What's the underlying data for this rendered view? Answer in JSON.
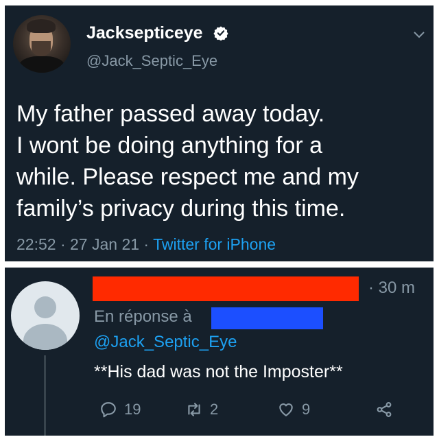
{
  "tweet": {
    "display_name": "Jacksepticeye",
    "handle": "@Jack_Septic_Eye",
    "text_lines": [
      "My father passed away today.",
      "I wont be doing anything for a",
      "while. Please respect me and my",
      "family’s privacy during this time."
    ],
    "time": "22:52",
    "date": "27 Jan 21",
    "source": "Twitter for iPhone",
    "separator": " · "
  },
  "reply": {
    "time": "· 30 m",
    "replying_to_label": "En réponse à",
    "replying_handle": "@Jack_Septic_Eye",
    "text": "**His dad was not the Imposter**",
    "counts": {
      "replies": "19",
      "retweets": "2",
      "likes": "9"
    }
  },
  "colors": {
    "background": "#15202b",
    "text": "#ffffff",
    "secondary": "#8899a6",
    "link": "#1da1f2",
    "redact_red": "#ff2a00",
    "redact_blue": "#1c4fff"
  },
  "icons": [
    "verified-icon",
    "chevron-down-icon",
    "reply-icon",
    "retweet-icon",
    "like-icon",
    "share-icon"
  ]
}
